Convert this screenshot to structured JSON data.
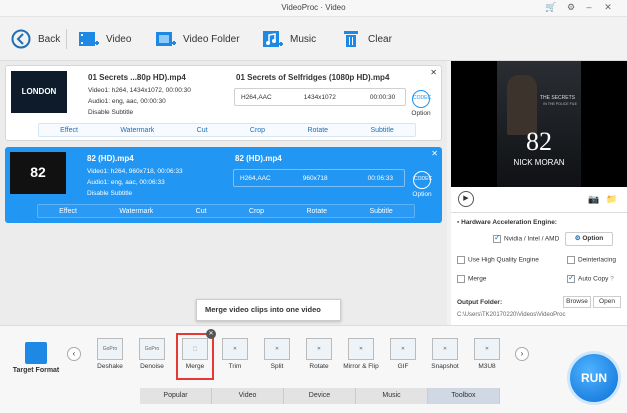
{
  "window": {
    "title": "VideoProc · Video"
  },
  "toolbar": {
    "back": "Back",
    "video": "Video",
    "video_folder": "Video Folder",
    "music": "Music",
    "clear": "Clear"
  },
  "items": [
    {
      "input_name": "01 Secrets ...80p HD).mp4",
      "output_name": "01 Secrets of Selfridges (1080p HD).mp4",
      "video_info": "Video1: h264, 1434x1072, 00:00:30",
      "audio_info": "Audio1: eng, aac, 00:00:30",
      "subtitle_info": "Disable Subtitle",
      "out_codec": "H264,AAC",
      "out_res": "1434x1072",
      "out_dur": "00:00:30",
      "thumb_text": "LONDON"
    },
    {
      "input_name": "82 (HD).mp4",
      "output_name": "82 (HD).mp4",
      "video_info": "Video1: h264, 960x718, 00:06:33",
      "audio_info": "Audio1: eng, aac, 00:06:33",
      "subtitle_info": "Disable Subtitle",
      "out_codec": "H264,AAC",
      "out_res": "960x718",
      "out_dur": "00:06:33",
      "thumb_text": "82"
    }
  ],
  "item_actions": [
    "Effect",
    "Watermark",
    "Cut",
    "Crop",
    "Rotate",
    "Subtitle"
  ],
  "codec_option": "Option",
  "preview": {
    "poster_line1": "THE SECRETS",
    "poster_line2": "IN THE POLICE FILE",
    "poster_number": "82",
    "poster_name": "NICK MORAN"
  },
  "settings": {
    "hw_title": "Hardware Acceleration Engine:",
    "hw_value": "Nvidia / Intel / AMD",
    "option_btn": "Option",
    "high_quality": "Use High Quality Engine",
    "deinterlacing": "Deinterlacing",
    "merge": "Merge",
    "auto_copy": "Auto Copy",
    "output_folder_label": "Output Folder:",
    "browse": "Browse",
    "open": "Open",
    "output_path": "C:\\Users\\TK20170220\\Videos\\VideoProc"
  },
  "bottom": {
    "target_format": "Target Format",
    "tooltip": "Merge video clips into one video",
    "formats": [
      {
        "label": "Deshake",
        "icon": "GoPro"
      },
      {
        "label": "Denoise",
        "icon": "GoPro"
      },
      {
        "label": "Merge",
        "icon": ""
      },
      {
        "label": "Trim",
        "icon": ""
      },
      {
        "label": "Split",
        "icon": ""
      },
      {
        "label": "Rotate",
        "icon": ""
      },
      {
        "label": "Mirror & Flip",
        "icon": ""
      },
      {
        "label": "GIF",
        "icon": ""
      },
      {
        "label": "Snapshot",
        "icon": ""
      },
      {
        "label": "M3U8",
        "icon": ""
      }
    ],
    "tabs": [
      "Popular",
      "Video",
      "Device",
      "Music",
      "Toolbox"
    ],
    "active_tab": "Toolbox",
    "run": "RUN"
  },
  "colors": {
    "accent": "#2196f3",
    "highlight": "#e53935"
  }
}
